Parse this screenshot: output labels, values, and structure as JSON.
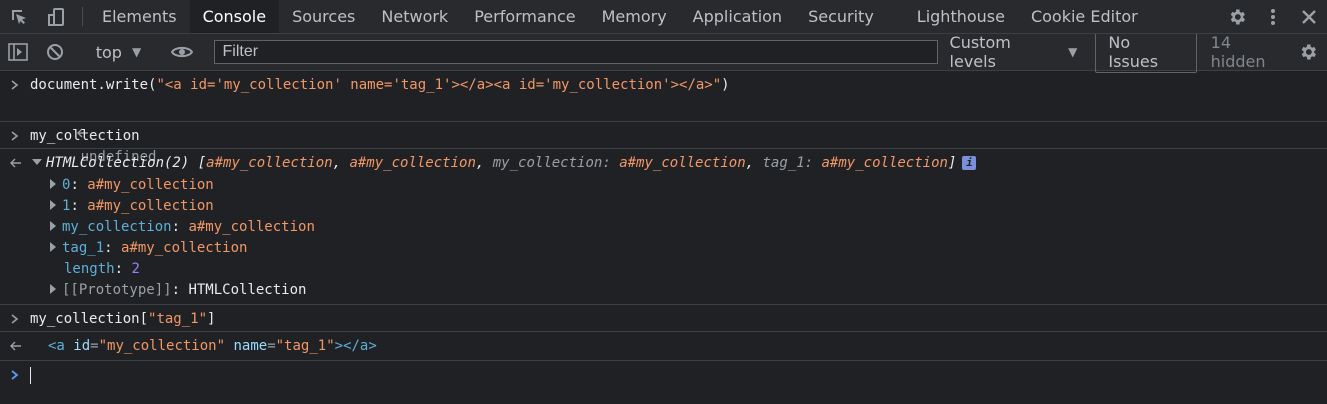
{
  "tabs": {
    "items": [
      "Elements",
      "Console",
      "Sources",
      "Network",
      "Performance",
      "Memory",
      "Application",
      "Security",
      "Lighthouse",
      "Cookie Editor"
    ],
    "active": "Console"
  },
  "toolbar": {
    "context": "top",
    "filter_placeholder": "Filter",
    "levels": "Custom levels",
    "issues": "No Issues",
    "hidden": "14 hidden"
  },
  "console": {
    "entry1": {
      "cmd_prefix": "document.write(",
      "cmd_string": "\"<a id='my_collection' name='tag_1'></a><a id='my_collection'></a>\"",
      "cmd_suffix": ")",
      "result": "undefined"
    },
    "entry2": {
      "cmd": "my_collection",
      "summary": {
        "type": "HTMLCollection(2)",
        "open": " [",
        "item0": "a#my_collection",
        "sep": ", ",
        "item1": "a#my_collection",
        "k1": "my_collection",
        "v1": "a#my_collection",
        "k2": "tag_1",
        "v2": "a#my_collection",
        "close": "]"
      },
      "children": [
        {
          "key": "0",
          "value": "a#my_collection"
        },
        {
          "key": "1",
          "value": "a#my_collection"
        },
        {
          "key": "my_collection",
          "value": "a#my_collection"
        },
        {
          "key": "tag_1",
          "value": "a#my_collection"
        }
      ],
      "length_key": "length",
      "length_value": "2",
      "proto_key": "[[Prototype]]",
      "proto_value": "HTMLCollection"
    },
    "entry3": {
      "cmd_prefix": "my_collection[",
      "cmd_string": "\"tag_1\"",
      "cmd_suffix": "]",
      "result": {
        "open": "<a",
        "attr1": "id",
        "val1": "\"my_collection\"",
        "attr2": "name",
        "val2": "\"tag_1\"",
        "close": "></a>"
      }
    }
  }
}
